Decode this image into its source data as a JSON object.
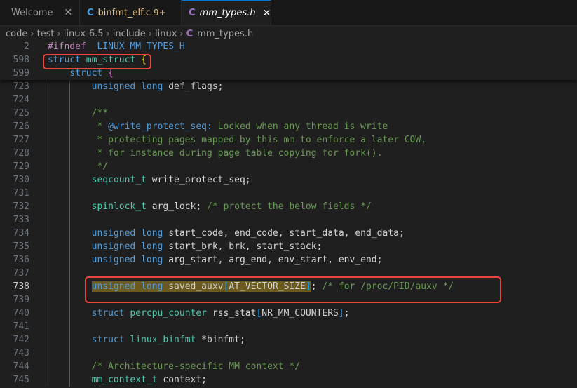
{
  "tabs": [
    {
      "label": "Welcome",
      "close": "✕",
      "icon": "vscode-logo-icon"
    },
    {
      "label": "binfmt_elf.c",
      "badge": "9+",
      "icon_glyph": "C"
    },
    {
      "label": "mm_types.h",
      "close": "✕",
      "icon_glyph": "C"
    }
  ],
  "breadcrumb": {
    "parts": [
      "code",
      "test",
      "linux-6.5",
      "include",
      "linux"
    ],
    "file_icon": "C",
    "file": "mm_types.h",
    "separator": "›"
  },
  "sticky": [
    {
      "num": "2",
      "text": "#ifndef _LINUX_MM_TYPES_H"
    },
    {
      "num": "598",
      "text": "struct mm_struct {"
    },
    {
      "num": "599",
      "text": "struct {"
    }
  ],
  "lines": [
    {
      "num": "723",
      "text": "unsigned long def_flags;"
    },
    {
      "num": "724",
      "text": ""
    },
    {
      "num": "725",
      "text": "/**"
    },
    {
      "num": "726",
      "text": " * @write_protect_seq: Locked when any thread is write"
    },
    {
      "num": "727",
      "text": " * protecting pages mapped by this mm to enforce a later COW,"
    },
    {
      "num": "728",
      "text": " * for instance during page table copying for fork()."
    },
    {
      "num": "729",
      "text": " */"
    },
    {
      "num": "730",
      "text": "seqcount_t write_protect_seq;"
    },
    {
      "num": "731",
      "text": ""
    },
    {
      "num": "732",
      "text": "spinlock_t arg_lock; /* protect the below fields */"
    },
    {
      "num": "733",
      "text": ""
    },
    {
      "num": "734",
      "text": "unsigned long start_code, end_code, start_data, end_data;"
    },
    {
      "num": "735",
      "text": "unsigned long start_brk, brk, start_stack;"
    },
    {
      "num": "736",
      "text": "unsigned long arg_start, arg_end, env_start, env_end;"
    },
    {
      "num": "737",
      "text": ""
    },
    {
      "num": "738",
      "text": "unsigned long saved_auxv[AT_VECTOR_SIZE]; /* for /proc/PID/auxv */"
    },
    {
      "num": "739",
      "text": ""
    },
    {
      "num": "740",
      "text": "struct percpu_counter rss_stat[NR_MM_COUNTERS];"
    },
    {
      "num": "741",
      "text": ""
    },
    {
      "num": "742",
      "text": "struct linux_binfmt *binfmt;"
    },
    {
      "num": "743",
      "text": ""
    },
    {
      "num": "744",
      "text": "/* Architecture-specific MM context */"
    },
    {
      "num": "745",
      "text": "mm_context_t context;"
    }
  ],
  "colors": {
    "annotation_box": "#e8453c",
    "highlight": "#6b5a1e",
    "accent": "#0078d4"
  }
}
